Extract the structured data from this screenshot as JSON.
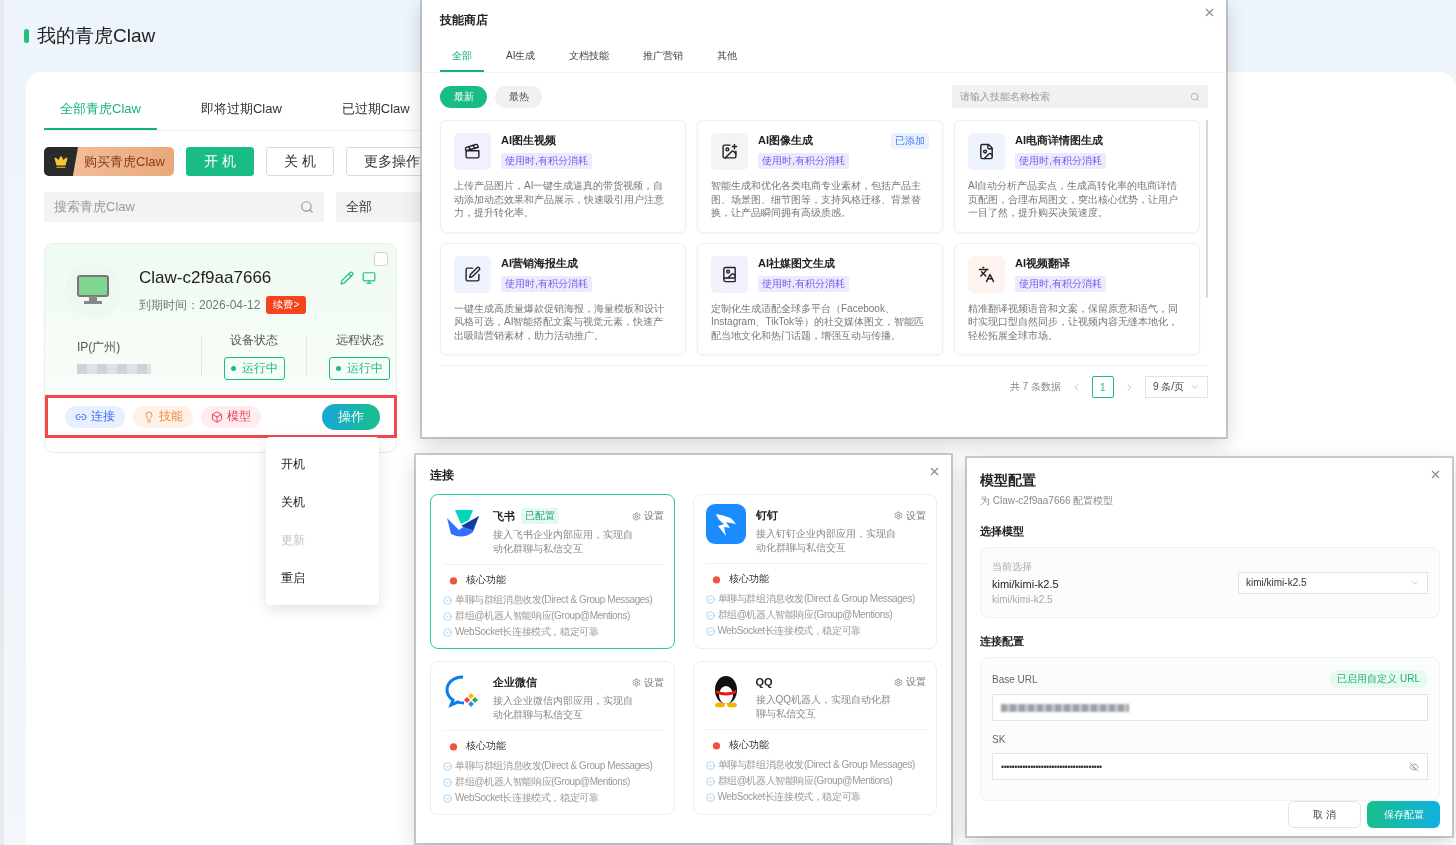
{
  "page": {
    "title": "我的青虎Claw"
  },
  "tabs": [
    {
      "label": "全部青虎Claw",
      "selected": true
    },
    {
      "label": "即将过期Claw",
      "selected": false
    },
    {
      "label": "已过期Claw",
      "selected": false
    }
  ],
  "toolbar": {
    "buy": "购买青虎Claw",
    "buttons": [
      {
        "label": "开 机",
        "kind": "primary"
      },
      {
        "label": "关 机",
        "kind": "outline"
      },
      {
        "label": "更多操作",
        "kind": "outline"
      }
    ]
  },
  "search": {
    "placeholder": "搜索青虎Claw"
  },
  "filter": {
    "value": "全部"
  },
  "instance": {
    "name": "Claw-c2f9aa7666",
    "checked": false,
    "expiry_label": "到期时间：",
    "expiry": "2026-04-12",
    "renew": "续费>",
    "ip_label": "IP(广州)",
    "device_status_label": "设备状态",
    "device_status": "运行中",
    "remote_status_label": "远程状态",
    "remote_status": "运行中",
    "action": "操作",
    "chips": [
      {
        "label": "连接",
        "kind": "link"
      },
      {
        "label": "技能",
        "kind": "skill"
      },
      {
        "label": "模型",
        "kind": "model"
      }
    ]
  },
  "action_menu": [
    {
      "label": "开机",
      "disabled": false
    },
    {
      "label": "关机",
      "disabled": false
    },
    {
      "label": "更新",
      "disabled": true
    },
    {
      "label": "重启",
      "disabled": false
    }
  ],
  "skill_store": {
    "title": "技能商店",
    "tabs": [
      {
        "label": "全部",
        "selected": true
      },
      {
        "label": "AI生成",
        "selected": false
      },
      {
        "label": "文档技能",
        "selected": false
      },
      {
        "label": "推广营销",
        "selected": false
      },
      {
        "label": "其他",
        "selected": false
      }
    ],
    "sorts": [
      {
        "label": "最新",
        "selected": true
      },
      {
        "label": "最热",
        "selected": false
      }
    ],
    "search": {
      "placeholder": "请输入技能名称检索"
    },
    "skills": [
      {
        "name": "AI图生视频",
        "tag": "使用时,有积分消耗",
        "description": "上传产品图片，AI一键生成逼真的带货视频，自动添加动态效果和产品展示，快速吸引用户注意力，提升转化率。"
      },
      {
        "name": "AI图像生成",
        "tag": "使用时,有积分消耗",
        "badge": "已添加",
        "description": "智能生成和优化各类电商专业素材，包括产品主图、场景图、细节图等，支持风格迁移、背景替换，让产品瞬间拥有高级质感。"
      },
      {
        "name": "AI电商详情图生成",
        "tag": "使用时,有积分消耗",
        "description": "AI自动分析产品卖点，生成高转化率的电商详情页配图，合理布局图文，突出核心优势，让用户一目了然，提升购买决策速度。"
      },
      {
        "name": "AI营销海报生成",
        "tag": "使用时,有积分消耗",
        "description": "一键生成高质量爆款促销海报，海量模板和设计风格可选，AI智能搭配文案与视觉元素，快速产出吸睛营销素材，助力活动推广。"
      },
      {
        "name": "AI社媒图文生成",
        "tag": "使用时,有积分消耗",
        "description": "定制化生成适配全球多平台（Facebook、Instagram、TikTok等）的社交媒体图文，智能匹配当地文化和热门话题，增强互动与传播。"
      },
      {
        "name": "AI视频翻译",
        "tag": "使用时,有积分消耗",
        "description": "精准翻译视频语音和文案，保留原意和语气，同时实现口型自然同步，让视频内容无缝本地化，轻松拓展全球市场。"
      }
    ],
    "pagination": {
      "total": "共 7 条数据",
      "pages": [
        {
          "label": "1",
          "selected": true
        }
      ],
      "page_size": "9 条/页"
    }
  },
  "connect_dialog": {
    "title": "连接",
    "integrations": [
      {
        "name": "飞书",
        "badge": "已配置",
        "selected": true,
        "settings": "设置",
        "description": "接入飞书企业内部应用，实现自动化群聊与私信交互",
        "features_title": "核心功能",
        "features": [
          "单聊与群组消息收发(Direct & Group Messages)",
          "群组@机器人智能响应(Group@Mentions)",
          "WebSocket长连接模式，稳定可靠"
        ]
      },
      {
        "name": "钉钉",
        "selected": false,
        "settings": "设置",
        "description": "接入钉钉企业内部应用，实现自动化群聊与私信交互",
        "features_title": "核心功能",
        "features": [
          "单聊与群组消息收发(Direct & Group Messages)",
          "群组@机器人智能响应(Group@Mentions)",
          "WebSocket长连接模式，稳定可靠"
        ]
      },
      {
        "name": "企业微信",
        "selected": false,
        "settings": "设置",
        "description": "接入企业微信内部应用，实现自动化群聊与私信交互",
        "features_title": "核心功能",
        "features": [
          "单聊与群组消息收发(Direct & Group Messages)",
          "群组@机器人智能响应(Group@Mentions)",
          "WebSocket长连接模式，稳定可靠"
        ]
      },
      {
        "name": "QQ",
        "selected": false,
        "settings": "设置",
        "description": "接入QQ机器人，实现自动化群聊与私信交互",
        "features_title": "核心功能",
        "features": [
          "单聊与群组消息收发(Direct & Group Messages)",
          "群组@机器人智能响应(Group@Mentions)",
          "WebSocket长连接模式，稳定可靠"
        ]
      }
    ]
  },
  "model_dialog": {
    "title": "模型配置",
    "subtitle": "为 Claw-c2f9aa7666 配置模型",
    "model_section": "选择模型",
    "current_label": "当前选择",
    "current": "kimi/kimi-k2.5",
    "current_sub": "kimi/kimi-k2.5",
    "select_value": "kimi/kimi-k2.5",
    "connection_section": "连接配置",
    "base_url_label": "Base URL",
    "custom_badge": "已启用自定义 URL",
    "sk_label": "SK",
    "sk_value": "••••••••••••••••••••••••••••••••••••••",
    "buttons": [
      {
        "label": "取 消",
        "kind": "outline"
      },
      {
        "label": "保存配置",
        "kind": "primary"
      }
    ]
  }
}
